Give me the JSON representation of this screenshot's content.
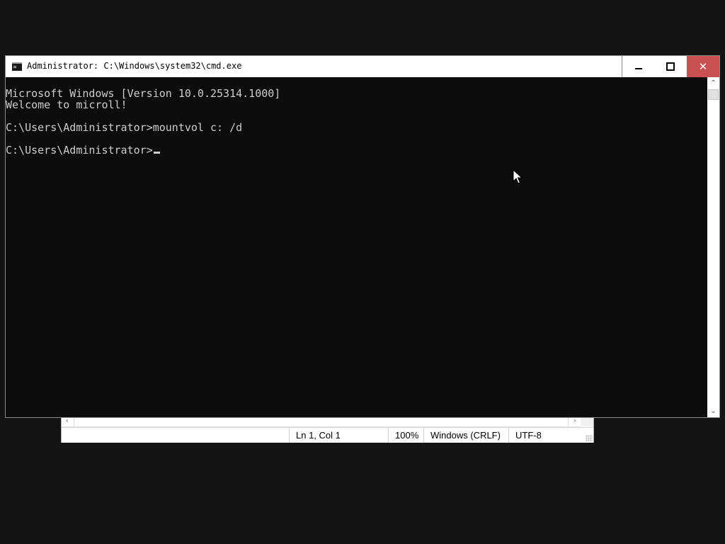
{
  "console_window": {
    "title": "Administrator: C:\\Windows\\system32\\cmd.exe",
    "icon": "console-app-icon",
    "caption_buttons": {
      "minimize_icon": "minimize-icon",
      "maximize_icon": "maximize-icon",
      "close_glyph": "✕",
      "close_color": "#c75050"
    },
    "lines": [
      "Microsoft Windows [Version 10.0.25314.1000]",
      "Welcome to microll!",
      "",
      "C:\\Users\\Administrator>mountvol c: /d",
      "",
      "C:\\Users\\Administrator>"
    ],
    "background_color": "#0c0c0c",
    "text_color": "#cccccc"
  },
  "notepad_statusbar": {
    "position": "Ln 1, Col 1",
    "zoom": "100%",
    "line_ending": "Windows (CRLF)",
    "encoding": "UTF-8"
  },
  "desktop": {
    "background_color": "#141414"
  }
}
